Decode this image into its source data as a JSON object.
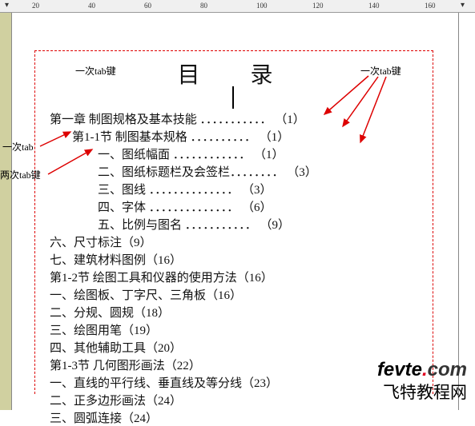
{
  "ruler": {
    "ticks": [
      "20",
      "40",
      "60",
      "80",
      "100",
      "120",
      "140",
      "160"
    ]
  },
  "title": "目 录",
  "annotations": {
    "tab1_top_left": "一次tab键",
    "tab_top_right": "一次tab键",
    "tab_left_1": "一次tab",
    "tab_left_2": "两次tab键"
  },
  "toc": [
    {
      "text": "第一章 制图规格及基本技能 ．．．．．．．．．．． （1）",
      "indent": 0
    },
    {
      "text": "第1-1节    制图基本规格  ．．．．．．．．．． （1）",
      "indent": 1
    },
    {
      "text": "一、图纸幅面  ．．．．．．．．．．．． （1）",
      "indent": 2
    },
    {
      "text": "二、图纸标题栏及会签栏．．．．．．．． （3）",
      "indent": 2
    },
    {
      "text": "三、图线  ．．．．．．．．．．．．．． （3）",
      "indent": 2
    },
    {
      "text": "四、字体  ．．．．．．．．．．．．．． （6）",
      "indent": 2
    },
    {
      "text": "五、比例与图名 ．．．．．．．．．．． （9）",
      "indent": 2
    }
  ],
  "flat": [
    "六、尺寸标注（9）",
    "七、建筑材料图例（16）",
    "第1-2节      绘图工具和仪器的使用方法（16）",
    "一、绘图板、丁字尺、三角板（16）",
    "二、分规、圆规（18）",
    "三、绘图用笔（19）",
    "四、其他辅助工具（20）",
    "第1-3节      几何图形画法（22）",
    "一、直线的平行线、垂直线及等分线（23）",
    "二、正多边形画法（24）",
    "三、圆弧连接（24）"
  ],
  "watermark": {
    "en1": "fevte",
    "en2": ".",
    "en3": "com",
    "cn": "飞特教程网"
  }
}
